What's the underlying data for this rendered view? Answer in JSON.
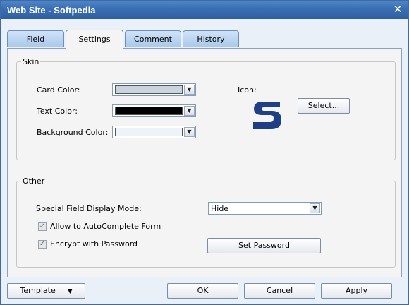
{
  "window": {
    "title": "Web Site - Softpedia",
    "close_glyph": "✕"
  },
  "tabs": [
    {
      "label": "Field",
      "active": false
    },
    {
      "label": "Settings",
      "active": true
    },
    {
      "label": "Comment",
      "active": false
    },
    {
      "label": "History",
      "active": false
    }
  ],
  "skin": {
    "legend": "Skin",
    "card_color_label": "Card Color:",
    "text_color_label": "Text Color:",
    "background_color_label": "Background Color:",
    "card_color": "#c9d4e0",
    "text_color": "#000000",
    "background_color": "#eef3fa",
    "icon_label": "Icon:",
    "icon_name": "softpedia-s-icon",
    "icon_color": "#1e3f86",
    "select_button": "Select..."
  },
  "other": {
    "legend": "Other",
    "display_mode_label": "Special Field Display Mode:",
    "display_mode_value": "Hide",
    "autocomplete_label": "Allow to AutoComplete Form",
    "autocomplete_checked": true,
    "encrypt_label": "Encrypt with Password",
    "encrypt_checked": true,
    "set_password_button": "Set Password"
  },
  "footer": {
    "template_button": "Template",
    "ok_button": "OK",
    "cancel_button": "Cancel",
    "apply_button": "Apply"
  },
  "icons": {
    "dropdown_arrow": "▼",
    "checkmark": "✓"
  }
}
